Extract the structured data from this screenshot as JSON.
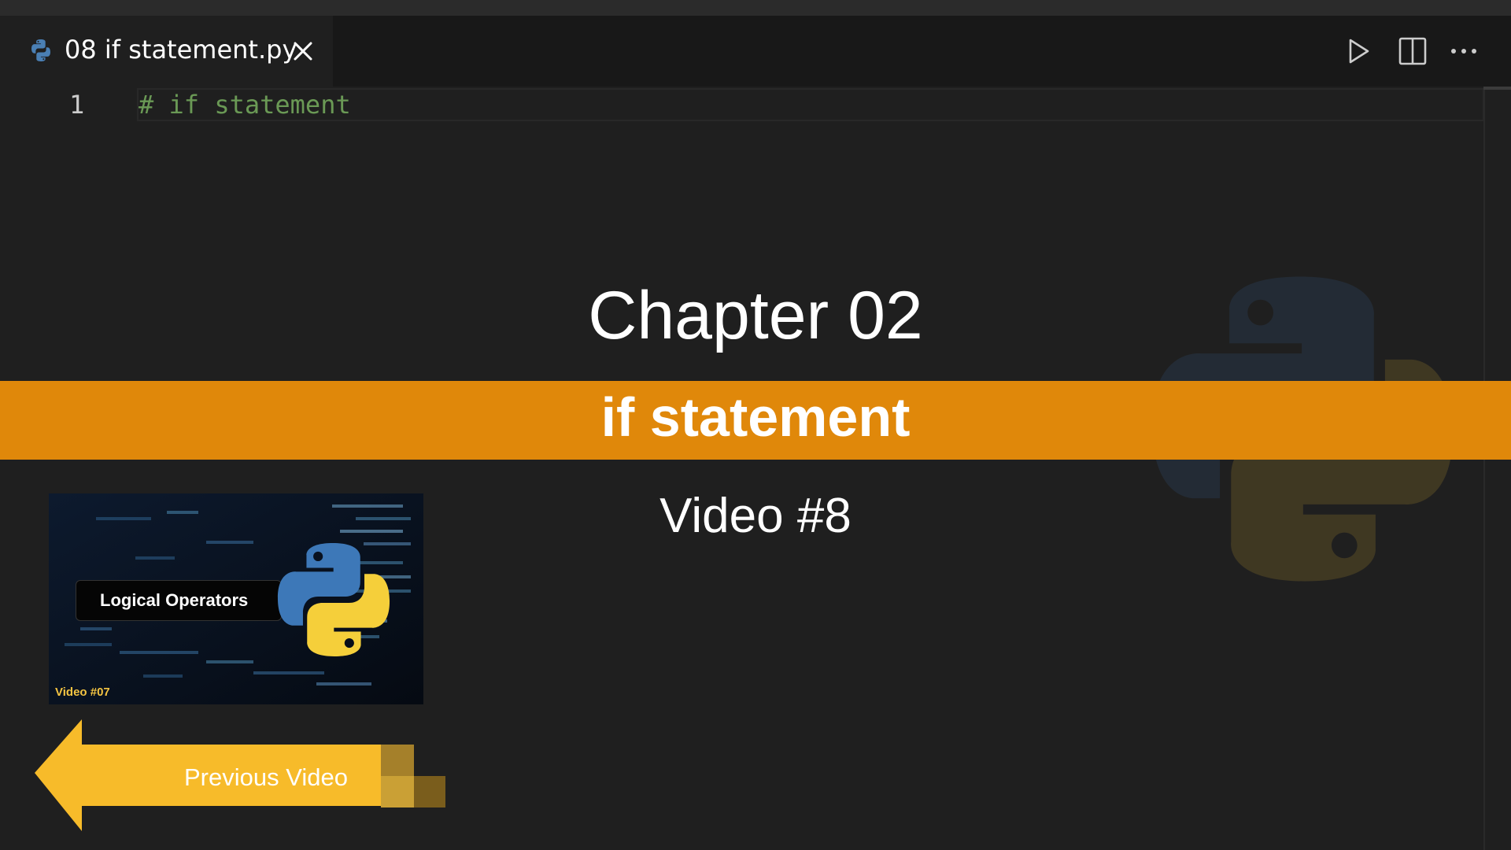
{
  "tab": {
    "filename": "08 if statement.py",
    "icon": "python-file-icon"
  },
  "toolbar": {
    "run_icon": "play-icon",
    "split_icon": "split-editor-icon",
    "more_icon": "more-actions-icon"
  },
  "editor": {
    "lines": [
      {
        "number": "1",
        "text": "# if statement"
      }
    ]
  },
  "overlay": {
    "chapter": "Chapter 02",
    "topic": "if statement",
    "video": "Video #8",
    "thumbnail": {
      "title": "Logical Operators",
      "video_label": "Video #07"
    },
    "previous_button": "Previous Video"
  },
  "colors": {
    "banner": "#e0880a",
    "comment": "#6a9955",
    "arrow": "#f7bb2a",
    "background": "#1f1f1f"
  }
}
